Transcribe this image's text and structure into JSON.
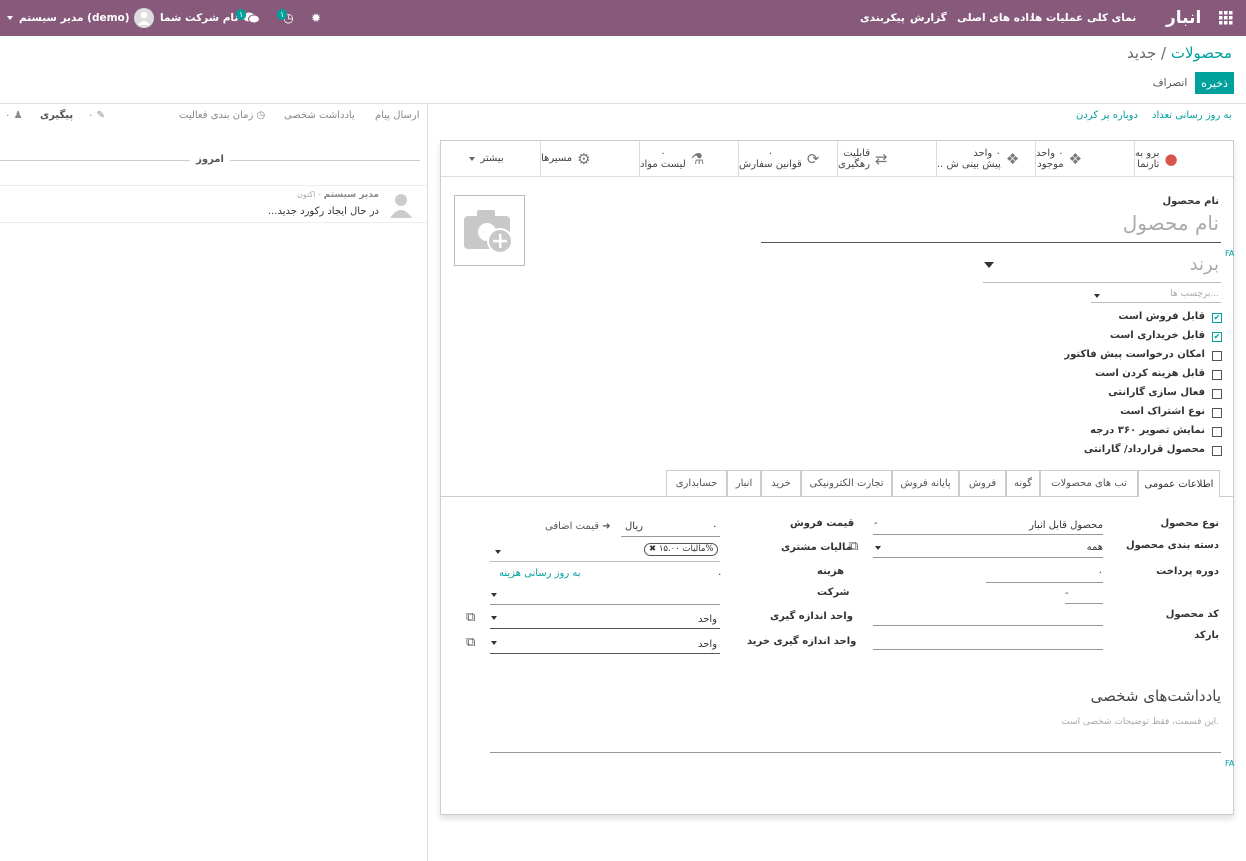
{
  "topbar": {
    "apps_icon": "grid-icon",
    "app_name": "انبار",
    "menu": [
      "نمای کلی",
      "عملیات ها",
      "داده های اصلی",
      "گزارش",
      "پیکربندی"
    ],
    "bug_icon": "bug-icon",
    "activity_count": "۱",
    "messages_count": "۱",
    "company": "نام شرکت شما",
    "user": "مدیر سیستم (demo)"
  },
  "breadcrumb": {
    "parent": "محصولات",
    "separator": "/",
    "current": "جدید"
  },
  "buttons": {
    "save": "ذخیره",
    "discard": "انصراف"
  },
  "actions": {
    "update_qty": "به روز رسانی تعداد",
    "replenish": "دوباره پر کردن"
  },
  "chatter": {
    "send_message": "ارسال پیام",
    "log_note": "یادداشت شخصی",
    "schedule_activity": "زمان بندی فعالیت",
    "attachments_count": "۰",
    "follow": "پیگیری",
    "followers_count": "۰",
    "today": "امروز",
    "author": "مدیر سیستم",
    "time": "- اکنون",
    "body": "در حال ایجاد رکورد جدید..."
  },
  "smart_buttons": [
    {
      "line1": "برو به",
      "line2": "تارنما",
      "icon": "globe-icon"
    },
    {
      "line1": "۰ واحد",
      "line2": "موجود",
      "icon": "cubes-icon"
    },
    {
      "line1": "۰ واحد",
      "line2": "پیش بینی ش ..",
      "icon": "cubes-icon"
    },
    {
      "line1": "قابلیت",
      "line2": "رهگیری",
      "icon": "arrows-icon"
    },
    {
      "line1": "۰",
      "line2": "قوانین سفارش",
      "icon": "refresh-icon"
    },
    {
      "line1": "۰",
      "line2": "لیست مواد",
      "icon": "flask-icon"
    },
    {
      "line1": "مسیرها",
      "line2": "",
      "icon": "cogs-icon"
    },
    {
      "line1": "بیشتر",
      "line2": "",
      "icon": "caret-down-icon"
    }
  ],
  "form": {
    "name_label": "نام محصول",
    "name_placeholder": "نام محصول",
    "brand_placeholder": "برند",
    "tags_placeholder": "برچسب ها...",
    "lang_badge": "FA",
    "checkboxes": [
      {
        "label": "قابل فروش است",
        "checked": true
      },
      {
        "label": "قابل خریداری است",
        "checked": true
      },
      {
        "label": "امکان درخواست پیش فاکتور",
        "checked": false
      },
      {
        "label": "قابل هزینه کردن است",
        "checked": false
      },
      {
        "label": "فعال سازی گارانتی",
        "checked": false
      },
      {
        "label": "نوع اشتراک است",
        "checked": false
      },
      {
        "label": "نمایش تصویر ۳۶۰ درجه",
        "checked": false
      },
      {
        "label": "محصول قرارداد/ گارانتی",
        "checked": false
      }
    ]
  },
  "tabs": [
    "اطلاعات عمومی",
    "تب های محصولات",
    "گونه",
    "فروش",
    "پایانه فروش",
    "تجارت الکترونیکی",
    "خرید",
    "انبار",
    "حسابداری"
  ],
  "general": {
    "type_label": "نوع محصول",
    "type_value": "محصول قابل انبار",
    "category_label": "دسته بندی محصول",
    "category_value": "همه",
    "period_label": "دوره پرداخت",
    "period_value": "۰",
    "code_label": "کد محصول",
    "barcode_label": "بارکد",
    "price_label": "قیمت فروش",
    "price_value": "۰",
    "currency": "ریال",
    "extra_price": "قیمت اضافی",
    "tax_label": "مالیات مشتری",
    "tax_tag": "مالیات ۱۵.۰۰%",
    "cost_label": "هزینه",
    "cost_value": "۰",
    "update_cost": "به روز رسانی هزینه",
    "company_label": "شرکت",
    "company_value": "-",
    "uom_label": "واحد اندازه گیری",
    "uom_value": "واحد",
    "uom_po_label": "واحد اندازه گیری خرید",
    "uom_po_value": "واحد",
    "type_dash": "-"
  },
  "notes": {
    "title": "یادداشت‌های شخصی",
    "placeholder": "این قسمت، فقط توضیحات شخصی است.",
    "lang_badge": "FA"
  }
}
